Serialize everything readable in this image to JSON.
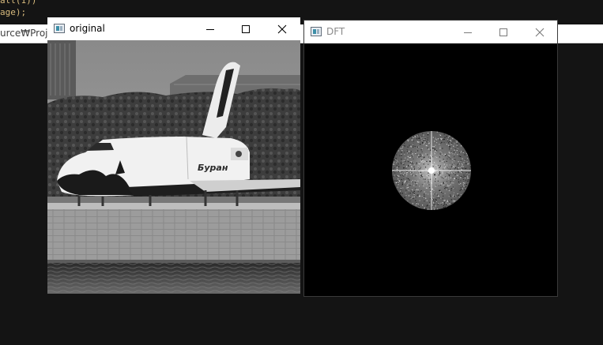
{
  "editor": {
    "code_lines": [
      "all(1))",
      "age);"
    ],
    "path_text": "urce₩Proje"
  },
  "windows": {
    "original": {
      "title": "original",
      "image_text": "Буран"
    },
    "dft": {
      "title": "DFT"
    }
  },
  "controls": {
    "minimize_icon": "minimize-icon",
    "maximize_icon": "maximize-icon",
    "close_icon": "close-icon"
  }
}
